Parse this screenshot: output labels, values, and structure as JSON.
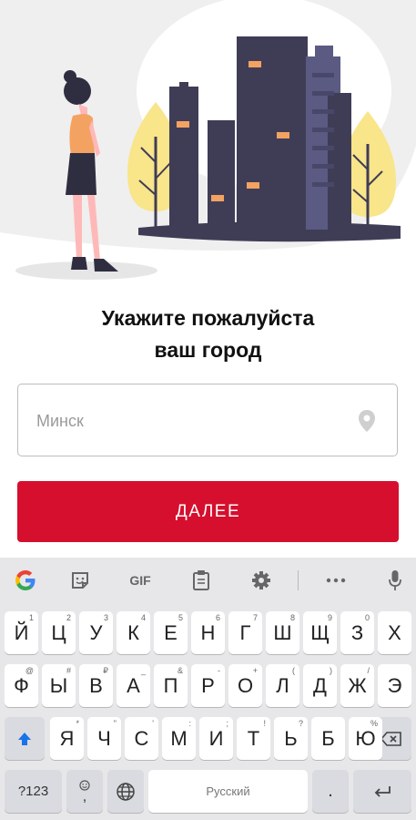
{
  "prompt": {
    "line1": "Укажите пожалуйста",
    "line2": "ваш город"
  },
  "city_input": {
    "value": "",
    "placeholder": "Минск"
  },
  "next_button": {
    "label": "ДАЛЕЕ"
  },
  "colors": {
    "accent": "#d50f2d",
    "keyboard_bg": "#e7e7e9"
  },
  "keyboard": {
    "toolbar": {
      "gif_label": "GIF",
      "icons": [
        "google-g-icon",
        "sticker-icon",
        "gif-icon",
        "clipboard-icon",
        "gear-icon",
        "more-icon",
        "microphone-icon"
      ]
    },
    "rows": [
      [
        {
          "c": "Й",
          "h": "1"
        },
        {
          "c": "Ц",
          "h": "2"
        },
        {
          "c": "У",
          "h": "3"
        },
        {
          "c": "К",
          "h": "4"
        },
        {
          "c": "Е",
          "h": "5"
        },
        {
          "c": "Н",
          "h": "6"
        },
        {
          "c": "Г",
          "h": "7"
        },
        {
          "c": "Ш",
          "h": "8"
        },
        {
          "c": "Щ",
          "h": "9"
        },
        {
          "c": "З",
          "h": "0"
        },
        {
          "c": "Х",
          "h": ""
        }
      ],
      [
        {
          "c": "Ф",
          "h": "@"
        },
        {
          "c": "Ы",
          "h": "#"
        },
        {
          "c": "В",
          "h": "₽"
        },
        {
          "c": "А",
          "h": "_"
        },
        {
          "c": "П",
          "h": "&"
        },
        {
          "c": "Р",
          "h": "-"
        },
        {
          "c": "О",
          "h": "+"
        },
        {
          "c": "Л",
          "h": "("
        },
        {
          "c": "Д",
          "h": ")"
        },
        {
          "c": "Ж",
          "h": "/"
        },
        {
          "c": "Э",
          "h": ""
        }
      ],
      [
        {
          "c": "Я",
          "h": "*"
        },
        {
          "c": "Ч",
          "h": "\""
        },
        {
          "c": "С",
          "h": "'"
        },
        {
          "c": "М",
          "h": ":"
        },
        {
          "c": "И",
          "h": ";"
        },
        {
          "c": "Т",
          "h": "!"
        },
        {
          "c": "Ь",
          "h": "?"
        },
        {
          "c": "Б",
          "h": ""
        },
        {
          "c": "Ю",
          "h": "%"
        }
      ]
    ],
    "symbols_label": "?123",
    "comma_label": ",",
    "space_label": "Русский",
    "period_label": "."
  }
}
